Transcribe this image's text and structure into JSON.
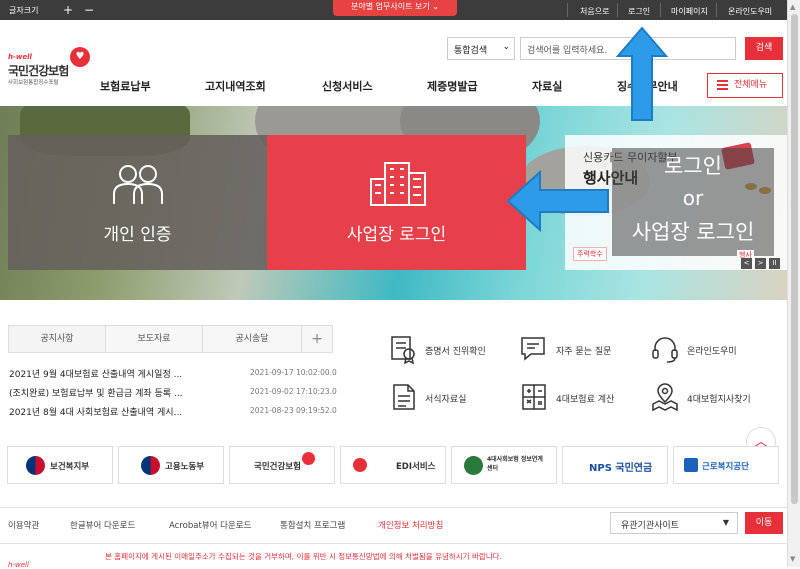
{
  "topbar": {
    "font_size_label": "글자크기",
    "font_plus": "+",
    "font_minus": "−",
    "field_sites": "분야별 업무사이트 보기",
    "links": [
      "처음으로",
      "로그인",
      "마이페이지",
      "온라인도우미"
    ]
  },
  "logo": {
    "hwell": "h-well",
    "name": "국민건강보험",
    "subtitle": "사회보험통합징수포털"
  },
  "search": {
    "select_value": "통합검색",
    "placeholder": "검색어를 입력하세요.",
    "button": "검색"
  },
  "gnb": {
    "items": [
      "보험료납부",
      "고지내역조회",
      "신청서비스",
      "제증명발급",
      "자료실",
      "징수업무안내"
    ],
    "all_menu": "전체메뉴"
  },
  "hero": {
    "personal_label": "개인 인증",
    "biz_label": "사업장 로그인",
    "event_line1": "신용카드 무이자할부",
    "event_line2": "행사안내",
    "overlay_login": "로그인",
    "overlay_or": "or",
    "overlay_biz": "사업장 로그인",
    "event_tag": "주력학수",
    "event_label": "행사",
    "controls": [
      "<",
      ">",
      "II"
    ]
  },
  "tabs": {
    "items": [
      "공지사항",
      "보도자료",
      "공시송달"
    ],
    "more": "+"
  },
  "news": [
    {
      "title": "2021년 9월 4대보험료 산출내역 게시일정 ...",
      "date": "2021-09-17 10:02:00.0"
    },
    {
      "title": "(조치완료) 보험료납부 및 환급금 계좌 등록 ...",
      "date": "2021-09-02 17:10:23.0"
    },
    {
      "title": "2021년 8월 4대 사회보험료 산출내역 게시...",
      "date": "2021-08-23 09:19:52.0"
    }
  ],
  "quick_links": [
    {
      "label": "증명서 진위확인",
      "icon": "certificate-icon"
    },
    {
      "label": "자주 묻는 질문",
      "icon": "faq-chat-icon"
    },
    {
      "label": "온라인도우미",
      "icon": "headset-icon"
    },
    {
      "label": "서식자료실",
      "icon": "document-icon"
    },
    {
      "label": "4대보험료 계산",
      "icon": "calculator-icon"
    },
    {
      "label": "4대보험지사찾기",
      "icon": "map-pin-icon"
    }
  ],
  "orgs": [
    "보건복지부",
    "고용노동부",
    "국민건강보험",
    "EDI서비스",
    "4대사회보험 정보연계센터",
    "NPS 국민연금",
    "근로복지공단"
  ],
  "footer": {
    "links": [
      "이용약관",
      "한글뷰어 다운로드",
      "Acrobat뷰어 다운로드",
      "통합설치 프로그램",
      "개인정보 처리방침"
    ],
    "related_select": "유관기관사이트",
    "go_button": "이동",
    "disclaimer": "본 홈페이지에 게시된 이메일주소가 수집되는 것을 거부하며, 이를 위반 시 정보통신망법에 의해 처벌됨을 유념하시기 바랍니다.",
    "mini_logo": "h-well"
  },
  "colors": {
    "brand_red": "#e8303a",
    "biz_red": "#e8404a",
    "personal_gray": "#64605c",
    "topbar": "#3c3c3c",
    "annotation_blue": "#2e9be8"
  }
}
